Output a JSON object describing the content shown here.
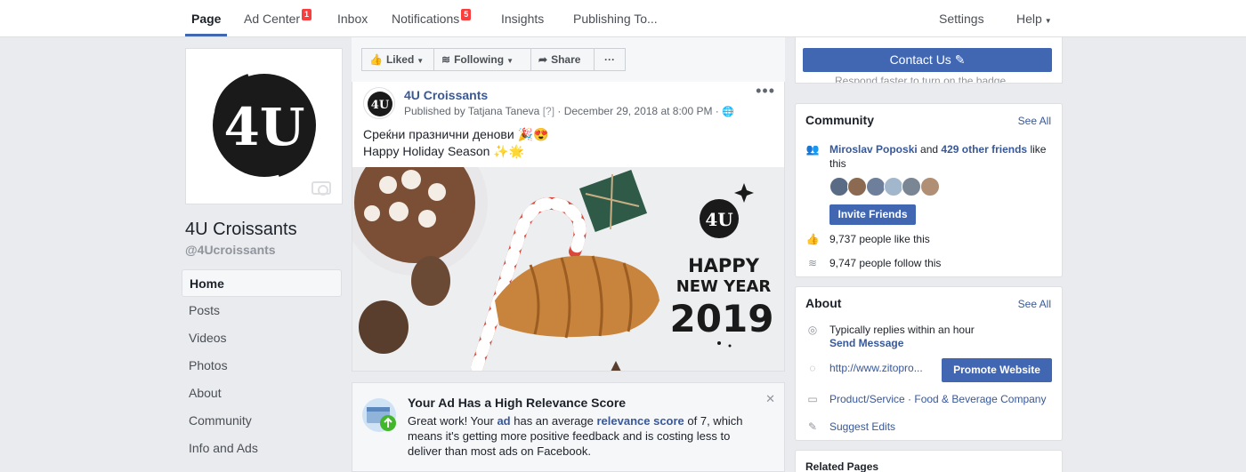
{
  "topnav": {
    "tabs": [
      {
        "label": "Page",
        "badge": ""
      },
      {
        "label": "Ad Center",
        "badge": "1"
      },
      {
        "label": "Inbox",
        "badge": ""
      },
      {
        "label": "Notifications",
        "badge": "5"
      },
      {
        "label": "Insights",
        "badge": ""
      },
      {
        "label": "Publishing To...",
        "badge": ""
      }
    ],
    "settings": "Settings",
    "help": "Help"
  },
  "page": {
    "name": "4U Croissants",
    "handle": "@4Ucroissants",
    "logo_text": "4U"
  },
  "leftnav": [
    "Home",
    "Posts",
    "Videos",
    "Photos",
    "About",
    "Community",
    "Info and Ads"
  ],
  "actions": {
    "liked": "Liked",
    "following": "Following",
    "share": "Share",
    "more": "···"
  },
  "post": {
    "page_name": "4U Croissants",
    "published_by": "Published by Tatjana Taneva",
    "help_mark": "[?]",
    "date": "· December 29, 2018 at 8:00 PM ·",
    "line1": "Среќни празнични денови 🎉😍",
    "line2": "Happy Holiday Season ✨🌟",
    "image_text": {
      "logo": "4U",
      "happy": "HAPPY",
      "new_year": "NEW YEAR",
      "year": "2019"
    }
  },
  "relevance": {
    "title": "Your Ad Has a High Relevance Score",
    "body_1": "Great work! Your ",
    "ad": "ad",
    "body_2": " has an average ",
    "relevance_score": "relevance score",
    "body_3": " of 7, which means it's getting more positive feedback and is costing less to deliver than most ads on Facebook."
  },
  "contact": {
    "button": "Contact Us",
    "subtext": "Respond faster to turn on the badge"
  },
  "community": {
    "title": "Community",
    "see_all": "See All",
    "friend_name": "Miroslav Poposki",
    "and": " and ",
    "others": "429 other friends",
    "like_this": " like",
    "this": "this",
    "invite": "Invite Friends",
    "likes": "9,737 people like this",
    "follows": "9,747 people follow this"
  },
  "about": {
    "title": "About",
    "see_all": "See All",
    "replies": "Typically replies within an hour",
    "send_message": "Send Message",
    "website": "http://www.zitopro...",
    "promote": "Promote Website",
    "category_1": "Product/Service",
    "category_sep": " · ",
    "category_2": "Food & Beverage Company",
    "suggest": "Suggest Edits"
  },
  "related": {
    "title": "Related Pages"
  },
  "colors": {
    "brand_blue": "#4267b2",
    "link_blue": "#385898",
    "badge_red": "#fa3e3e",
    "background": "#e9ebee"
  }
}
